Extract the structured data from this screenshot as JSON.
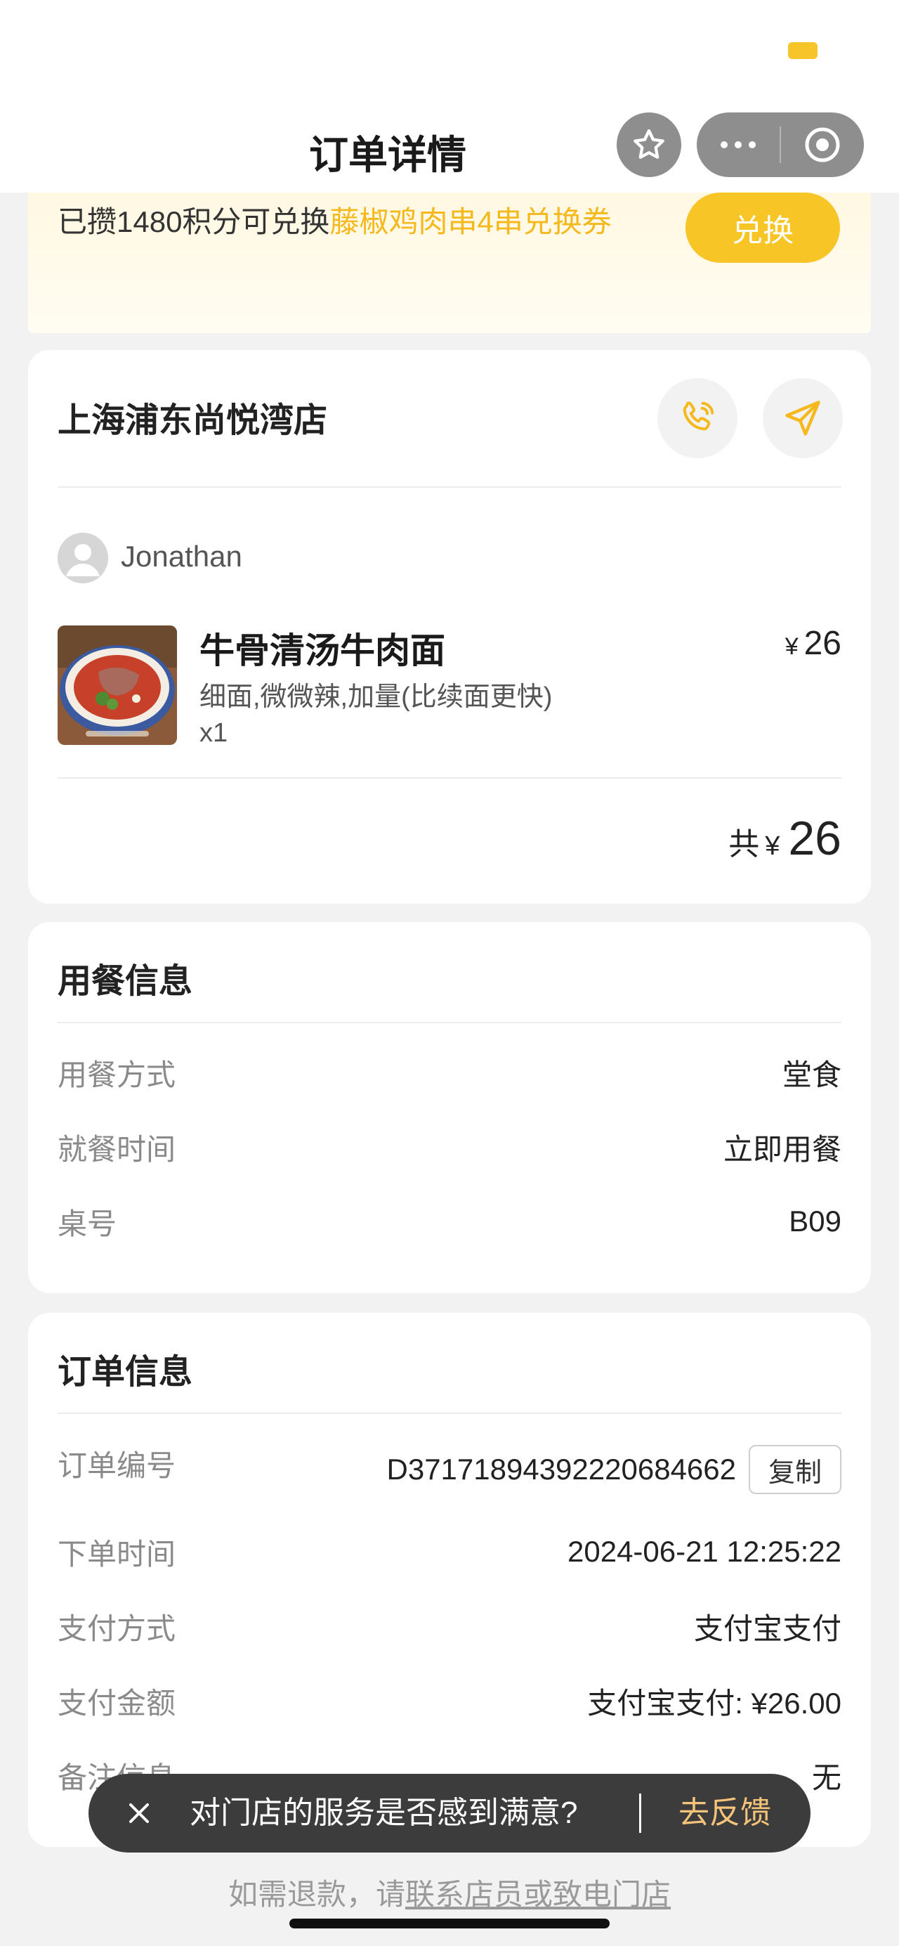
{
  "nav": {
    "title": "订单详情"
  },
  "promo": {
    "text_prefix": "已攒1480积分可兑换",
    "text_highlight": "藤椒鸡肉串4串兑换券",
    "button": "兑换"
  },
  "store": {
    "name": "上海浦东尚悦湾店",
    "user": "Jonathan",
    "item": {
      "name": "牛骨清汤牛肉面",
      "price_symbol": "¥",
      "price": "26",
      "spec": "细面,微微辣,加量(比续面更快)",
      "qty": "x1"
    },
    "total_label": "共",
    "total_symbol": "¥",
    "total": "26"
  },
  "dining": {
    "title": "用餐信息",
    "rows": [
      {
        "label": "用餐方式",
        "value": "堂食"
      },
      {
        "label": "就餐时间",
        "value": "立即用餐"
      },
      {
        "label": "桌号",
        "value": "B09"
      }
    ]
  },
  "order": {
    "title": "订单信息",
    "copy_button": "复制",
    "rows": [
      {
        "label": "订单编号",
        "value": "D3717189439222068466​2"
      },
      {
        "label": "下单时间",
        "value": "2024-06-21 12:25:22"
      },
      {
        "label": "支付方式",
        "value": "支付宝支付"
      },
      {
        "label": "支付金额",
        "value": "支付宝支付: ¥26.00"
      },
      {
        "label": "备注信息",
        "value": "无"
      }
    ]
  },
  "toast": {
    "question": "对门店的服务是否感到满意?",
    "action": "去反馈"
  },
  "footer": {
    "prefix": "如需退款，请",
    "link": "联系店员或致电门店"
  },
  "colors": {
    "accent": "#f8c526",
    "highlight_text": "#f5b91e",
    "toast_action": "#f5c37a"
  },
  "icons": {
    "star": "star-icon",
    "more": "more-dots-icon",
    "close_mini": "target-icon",
    "phone": "phone-icon",
    "navigate": "navigate-arrow-icon",
    "toast_close": "close-icon"
  }
}
